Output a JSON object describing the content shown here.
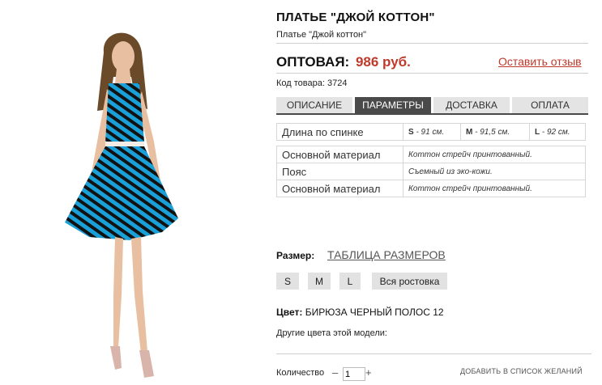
{
  "product": {
    "title": "ПЛАТЬЕ \"ДЖОЙ КОТТОН\"",
    "subtitle": "Платье \"Джой коттон\"",
    "price_label": "ОПТОВАЯ:",
    "price_value": "986 руб.",
    "review_link": "Оставить отзыв",
    "sku": "Код товара: 3724"
  },
  "tabs": [
    {
      "label": "ОПИСАНИЕ",
      "active": false
    },
    {
      "label": "ПАРАМЕТРЫ",
      "active": true
    },
    {
      "label": "ДОСТАВКА",
      "active": false
    },
    {
      "label": "ОПЛАТА",
      "active": false
    }
  ],
  "params": {
    "length_label": "Длина по спинке",
    "length_values": [
      {
        "size": "S",
        "value": "- 91 см."
      },
      {
        "size": "M",
        "value": "- 91,5 см."
      },
      {
        "size": "L",
        "value": "- 92 см."
      }
    ],
    "rows": [
      {
        "label": "Основной материал",
        "value": "Коттон стрейч принтованный."
      },
      {
        "label": "Пояс",
        "value": "Съемный из эко-кожи."
      },
      {
        "label": "Основной материал",
        "value": "Коттон стрейч принтованный."
      }
    ]
  },
  "size": {
    "label": "Размер:",
    "table_link": "ТАБЛИЦА РАЗМЕРОВ",
    "options": [
      "S",
      "M",
      "L"
    ],
    "all_sizes": "Вся ростовка"
  },
  "color": {
    "label": "Цвет:",
    "value": "БИРЮЗА ЧЕРНЫЙ ПОЛОС 12",
    "other_colors": "Другие цвета этой модели:"
  },
  "quantity": {
    "label": "Количество",
    "minus": "–",
    "value": "1",
    "plus": "+"
  },
  "wishlist": "ДОБАВИТЬ В СПИСОК ЖЕЛАНИЙ",
  "colors": {
    "accent": "#c0392b",
    "dress_blue": "#1aa0d8",
    "tab_active": "#4a4a4a",
    "tab_inactive": "#e4e4e4"
  }
}
